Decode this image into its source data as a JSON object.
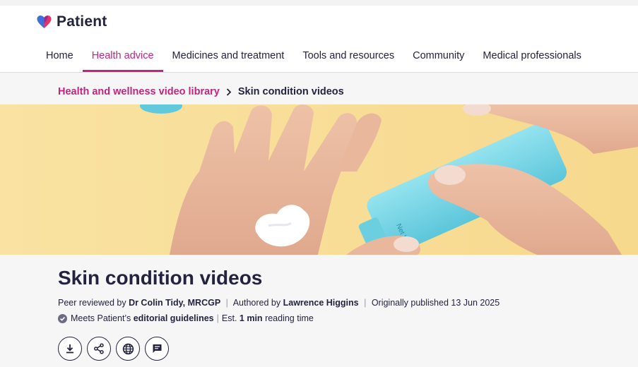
{
  "brand": {
    "name": "Patient"
  },
  "nav": {
    "items": [
      {
        "label": "Home"
      },
      {
        "label": "Health advice"
      },
      {
        "label": "Medicines and treatment"
      },
      {
        "label": "Tools and resources"
      },
      {
        "label": "Community"
      },
      {
        "label": "Medical professionals"
      }
    ],
    "active": "Health advice"
  },
  "breadcrumb": {
    "parent": "Health and wellness video library",
    "current": "Skin condition videos"
  },
  "article": {
    "title": "Skin condition videos",
    "peer_prefix": "Peer reviewed by",
    "peer_reviewer": "Dr Colin Tidy, MRCGP",
    "author_prefix": "Authored by",
    "author": "Lawrence Higgins",
    "published": "Originally published 13 Jun 2025",
    "guidelines_prefix": "Meets Patient’s",
    "guidelines_link": "editorial guidelines",
    "read_prefix": "Est.",
    "read_time": "1 min",
    "read_suffix": "reading time",
    "tube_text": "Net Wt. 1.06 oz (30g)"
  },
  "actions": [
    {
      "icon": "download-icon"
    },
    {
      "icon": "share-icon"
    },
    {
      "icon": "globe-icon"
    },
    {
      "icon": "comment-icon"
    }
  ],
  "colors": {
    "accent": "#c2247f",
    "text": "#23233f",
    "hero_bg": "#f8dc93",
    "tube": "#7fd8e8"
  }
}
